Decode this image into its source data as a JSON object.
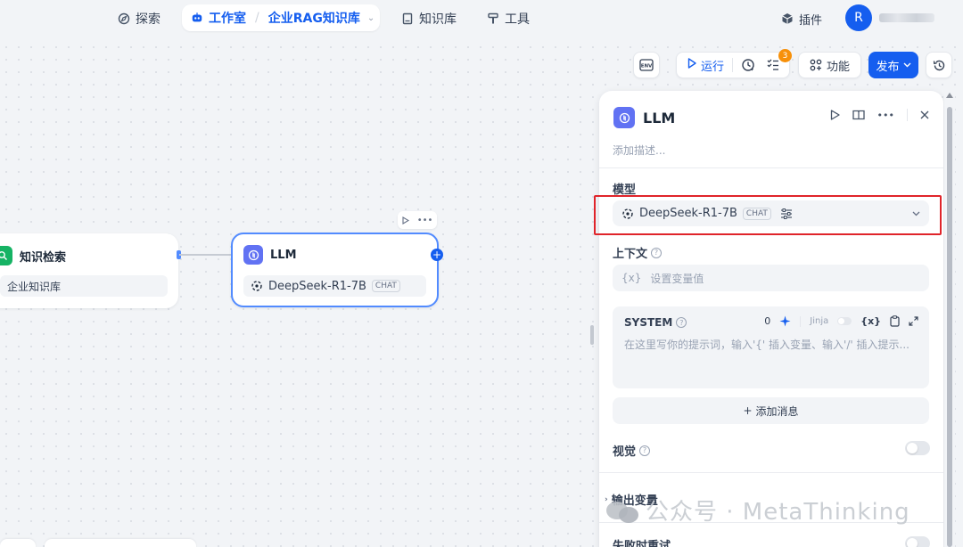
{
  "nav": {
    "explore": "探索",
    "studio": "工作室",
    "app_name": "企业RAG知识库",
    "knowledge": "知识库",
    "tools": "工具",
    "plugins": "插件",
    "avatar_letter": "R"
  },
  "toolbar": {
    "env_label": "ENV",
    "run_label": "运行",
    "checklist_count": "3",
    "features_label": "功能",
    "publish_label": "发布"
  },
  "nodes": {
    "retrieval": {
      "title": "知识检索",
      "item": "企业知识库"
    },
    "llm": {
      "title": "LLM",
      "model": "DeepSeek-R1-7B",
      "tag": "CHAT"
    }
  },
  "panel": {
    "title": "LLM",
    "description_placeholder": "添加描述...",
    "model_label": "模型",
    "model_name": "DeepSeek-R1-7B",
    "model_tag": "CHAT",
    "context_label": "上下文",
    "context_placeholder": "设置变量值",
    "context_var_icon": "{x}",
    "system_label": "SYSTEM",
    "token_count": "0",
    "jinja_label": "Jinja",
    "system_var_icon": "{x}",
    "system_placeholder": "在这里写你的提示词，输入'{' 插入变量、输入'/' 插入提示...",
    "add_message": "添加消息",
    "vision_label": "视觉",
    "output_vars_label": "输出变量",
    "retry_label": "失败时重试"
  },
  "watermark": {
    "text": "公众号 · MetaThinking"
  },
  "colors": {
    "primary": "#155eef",
    "highlight_box": "#e0242a",
    "badge": "#f79009"
  }
}
